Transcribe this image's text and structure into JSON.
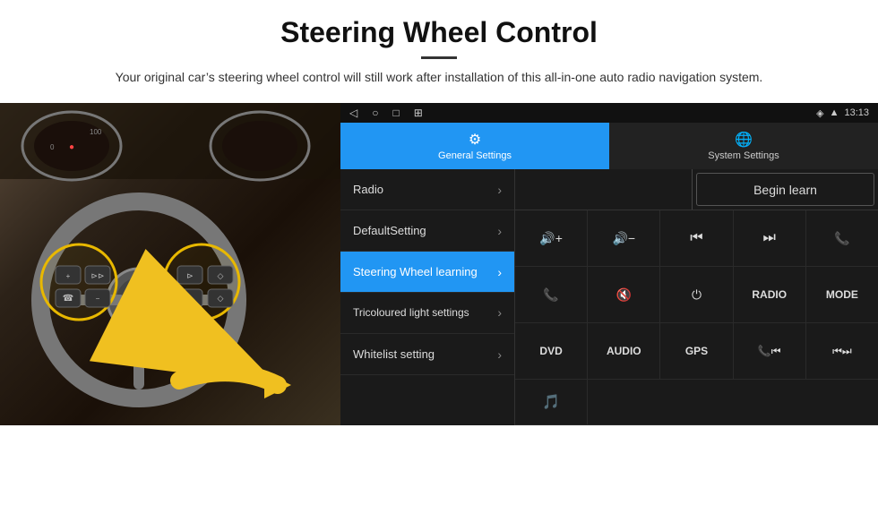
{
  "page": {
    "title": "Steering Wheel Control",
    "divider": true,
    "subtitle": "Your original car’s steering wheel control will still work after installation of this all-in-one auto radio navigation system."
  },
  "status_bar": {
    "time": "13:13",
    "nav_buttons": [
      "◁",
      "○",
      "□",
      "⊞"
    ]
  },
  "tabs": [
    {
      "id": "general",
      "label": "General Settings",
      "active": true,
      "icon": "⚙"
    },
    {
      "id": "system",
      "label": "System Settings",
      "active": false,
      "icon": "🌐"
    }
  ],
  "menu_items": [
    {
      "id": "radio",
      "label": "Radio",
      "active": false
    },
    {
      "id": "default",
      "label": "DefaultSetting",
      "active": false
    },
    {
      "id": "steering",
      "label": "Steering Wheel learning",
      "active": true
    },
    {
      "id": "tricoloured",
      "label": "Tricoloured light settings",
      "active": false
    },
    {
      "id": "whitelist",
      "label": "Whitelist setting",
      "active": false
    }
  ],
  "controls": {
    "begin_learn_label": "Begin learn",
    "rows": [
      [
        {
          "label": "🔊+",
          "type": "icon"
        },
        {
          "label": "🔊−",
          "type": "icon"
        },
        {
          "label": "⏮",
          "type": "icon"
        },
        {
          "label": "⏭",
          "type": "icon"
        },
        {
          "label": "📞",
          "type": "icon"
        }
      ],
      [
        {
          "label": "📞",
          "type": "icon-call"
        },
        {
          "label": "🔇",
          "type": "icon"
        },
        {
          "label": "⏻",
          "type": "icon"
        },
        {
          "label": "RADIO",
          "type": "text"
        },
        {
          "label": "MODE",
          "type": "text"
        }
      ],
      [
        {
          "label": "DVD",
          "type": "text"
        },
        {
          "label": "AUDIO",
          "type": "text"
        },
        {
          "label": "GPS",
          "type": "text"
        },
        {
          "label": "📞⏮",
          "type": "icon"
        },
        {
          "label": "⏮⏭",
          "type": "icon"
        }
      ],
      [
        {
          "label": "🎵",
          "type": "icon"
        }
      ]
    ]
  }
}
